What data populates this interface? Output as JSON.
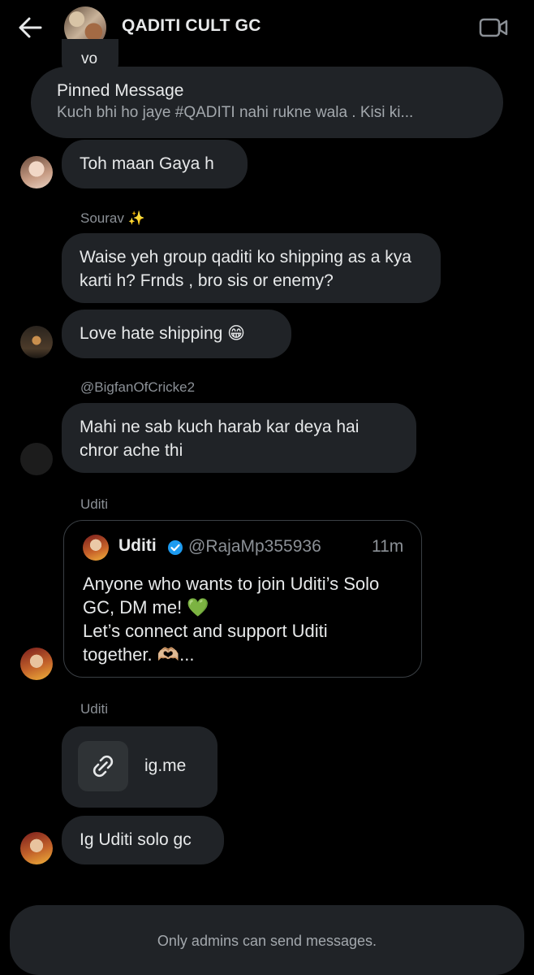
{
  "header": {
    "title": "QADITI CULT GC",
    "back_icon": "arrow-left-icon",
    "video_icon": "video-camera-icon"
  },
  "previous_message": {
    "text": "vo"
  },
  "pinned": {
    "title": "Pinned Message",
    "text": "Kuch bhi ho jaye #QADITI nahi rukne wala . Kisi ki..."
  },
  "messages": [
    {
      "text": "Toh maan Gaya h"
    },
    {
      "sender": "Sourav ✨",
      "text": "Waise yeh group qaditi ko shipping as a kya karti h? Frnds , bro sis or enemy?"
    },
    {
      "text": "Love hate shipping 😁"
    },
    {
      "sender": "@BigfanOfCricke2",
      "text": "Mahi ne sab kuch harab kar deya hai chror ache thi"
    },
    {
      "sender": "Uditi",
      "quote": {
        "name": "Uditi",
        "handle": "@RajaMp355936",
        "time": "11m",
        "text": "Anyone who wants to join Uditi’s Solo GC, DM me! 💚\nLet’s connect and support Uditi together. 🫶🏼..."
      }
    },
    {
      "sender": "Uditi",
      "link": "ig.me"
    },
    {
      "text": "Ig Uditi solo gc"
    }
  ],
  "composer": {
    "notice": "Only admins can send messages."
  },
  "colors": {
    "bubble": "#202327",
    "background": "#000000",
    "verified": "#1d9bf0",
    "muted": "#8b9096"
  }
}
